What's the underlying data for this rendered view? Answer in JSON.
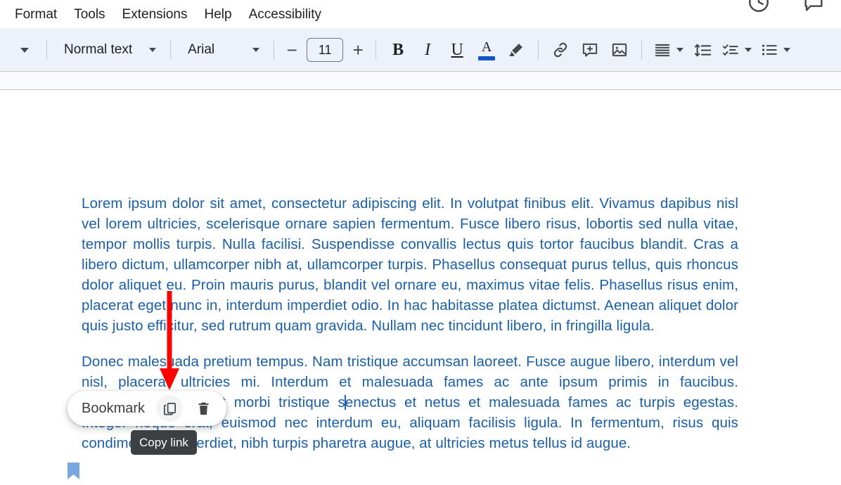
{
  "menubar": {
    "items": [
      {
        "label": "Format",
        "name": "menu-format"
      },
      {
        "label": "Tools",
        "name": "menu-tools"
      },
      {
        "label": "Extensions",
        "name": "menu-extensions"
      },
      {
        "label": "Help",
        "name": "menu-help"
      },
      {
        "label": "Accessibility",
        "name": "menu-accessibility"
      }
    ],
    "right_icons": [
      {
        "name": "version-history-icon"
      },
      {
        "name": "comment-history-icon"
      }
    ]
  },
  "toolbar": {
    "overflow_caret": "▾",
    "paragraph_style": "Normal text",
    "font_family": "Arial",
    "font_size": "11",
    "decrease_font_label": "−",
    "increase_font_label": "+",
    "bold_label": "B",
    "italic_label": "I",
    "underline_label": "U",
    "text_color_label": "A",
    "text_color_swatch": "#1155cc",
    "icons": [
      "highlight-pen-icon",
      "insert-link-icon",
      "add-comment-icon",
      "insert-image-icon",
      "align-icon",
      "line-spacing-icon",
      "checklist-icon",
      "bulleted-list-icon"
    ]
  },
  "document": {
    "paragraph1": "Lorem ipsum dolor sit amet, consectetur adipiscing elit. In volutpat finibus elit. Vivamus dapibus nisl vel lorem ultricies, scelerisque ornare sapien fermentum. Fusce libero risus, lobortis sed nulla vitae, tempor mollis turpis. Nulla facilisi. Suspendisse convallis lectus quis tortor faucibus blandit. Cras a libero dictum, ullamcorper nibh at, ullamcorper turpis. Phasellus consequat purus tellus, quis rhoncus dolor aliquet eu. Proin mauris purus, blandit vel ornare eu, maximus vitae felis. Phasellus risus enim, placerat eget nunc in, interdum imperdiet odio. In hac habitasse platea dictumst. Aenean aliquet dolor quis justo efficitur, sed rutrum quam gravida. Nullam nec tincidunt libero, in fringilla ligula.",
    "paragraph2_a": "Donec malesuada pretium tempus. Nam tristique accumsan laoreet. Fusce augue libero, interdum vel nisl, placerat ultricies mi. Interdum et malesuada fames ac ante ipsum primis in faucibus. Pellentesque habitant morbi tristique s",
    "paragraph2_b": "enectus et netus et malesuada fames ac turpis egestas. Integer neque erat, euismod nec interdum eu, aliquam facilisis ligula. In fermentum, risus quis condimentum imperdiet, nibh turpis pharetra augue, at ultricies metus tellus id augue.",
    "text_color": "#1a5fa8"
  },
  "bookmark": {
    "flag_icon": "bookmark-flag-icon",
    "popup_label": "Bookmark",
    "copy_icon": "copy-link-icon",
    "delete_icon": "delete-bookmark-icon",
    "tooltip": "Copy link"
  },
  "annotation": {
    "arrow_color": "#ff0000",
    "arrow_icon": "down-arrow-annotation"
  }
}
